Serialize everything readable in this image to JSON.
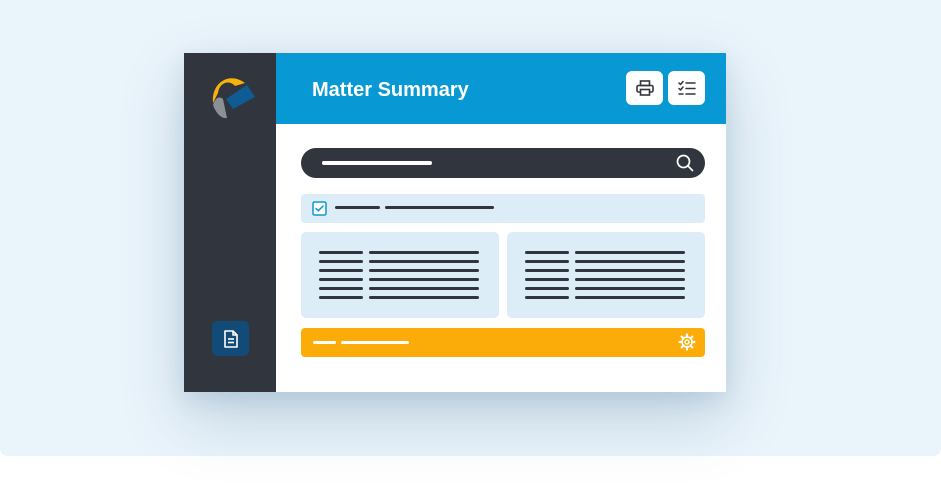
{
  "header": {
    "title": "Matter Summary"
  },
  "icons": {
    "logo": "app-logo",
    "sidebar_document": "document-icon",
    "print": "printer-icon",
    "checklist": "checklist-icon",
    "search": "search-icon",
    "checkbox": "checkbox-checked-icon",
    "settings": "gear-icon"
  },
  "state": {
    "checkbox_checked": true
  },
  "colors": {
    "header": "#0898d3",
    "sidebar": "#30353e",
    "sidebar_button": "#124b78",
    "panel": "#dcedf8",
    "action_bar": "#fbac09",
    "logo_yellow": "#f7b20c",
    "logo_blue": "#0f5c95",
    "logo_gray": "#8b8f96"
  }
}
